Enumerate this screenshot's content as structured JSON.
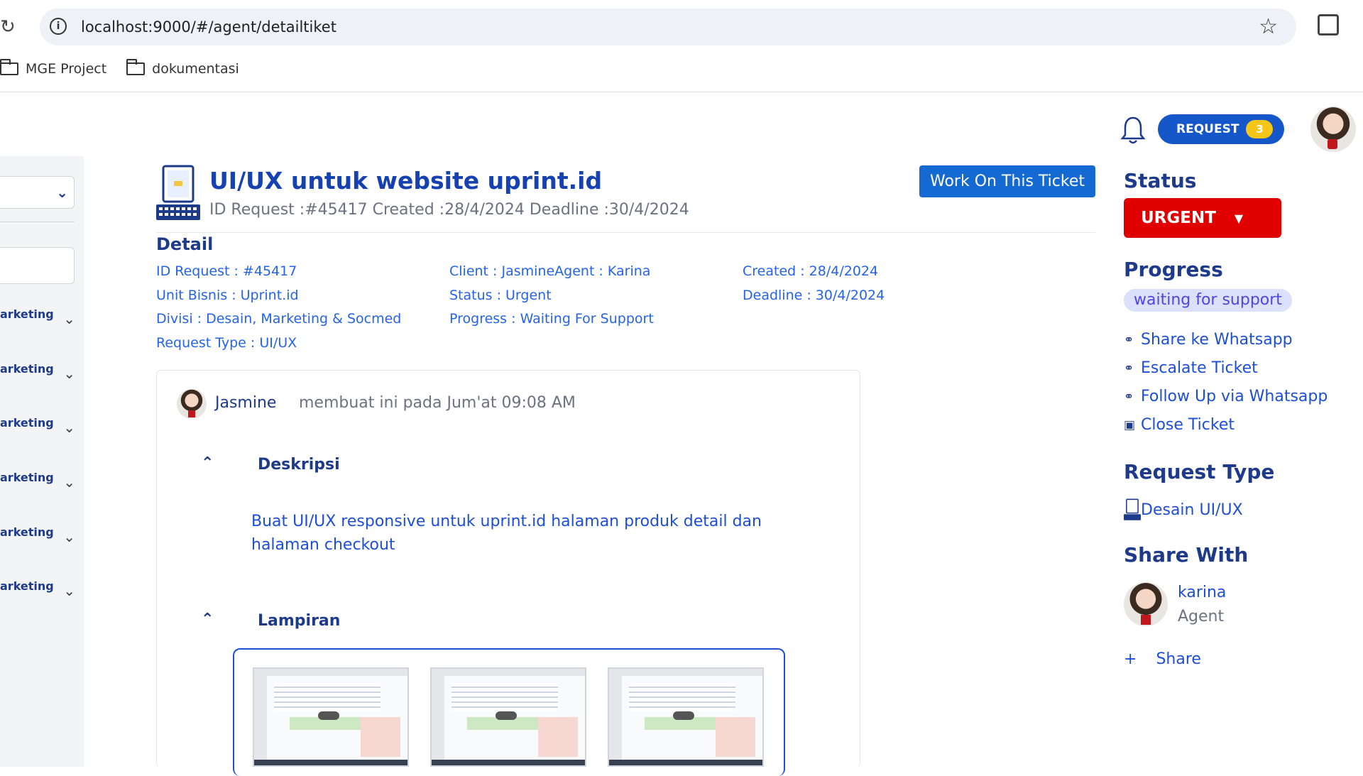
{
  "browser": {
    "url": "localhost:9000/#/agent/detailtiket",
    "bookmarks": [
      "MGE Project",
      "dokumentasi"
    ]
  },
  "topbar": {
    "request_label": "REQUEST",
    "request_count": "3"
  },
  "sidebar": {
    "items": [
      "arketing",
      "arketing",
      "arketing",
      "arketing",
      "arketing",
      "arketing"
    ]
  },
  "ticket": {
    "title": "UI/UX untuk website uprint.id",
    "subtitle": "ID Request :#45417  Created :28/4/2024  Deadline :30/4/2024",
    "work_button": "Work On This Ticket"
  },
  "detail": {
    "title": "Detail",
    "col1": [
      "ID Request  :  #45417",
      "Unit Bisnis  :  Uprint.id",
      "Divisi  :  Desain, Marketing & Socmed",
      "Request Type  :  UI/UX"
    ],
    "col2": [
      "Client  :  JasmineAgent  :  Karina",
      "Status  :  Urgent",
      "Progress  :  Waiting For Support"
    ],
    "col3": [
      "Created  :  28/4/2024",
      "Deadline  :  30/4/2024"
    ]
  },
  "card": {
    "author": "Jasmine",
    "created_note": "membuat ini pada Jum'at 09:08 AM",
    "description_title": "Deskripsi",
    "description": "Buat UI/UX responsive untuk uprint.id halaman produk detail dan halaman checkout",
    "attachments_title": "Lampiran",
    "attachment_count": 3
  },
  "right_panel": {
    "status_title": "Status",
    "status_value": "URGENT",
    "status_color": "#e00000",
    "progress_title": "Progress",
    "progress_value": "waiting for support",
    "actions": [
      {
        "label": "Share ke Whatsapp",
        "icon": "share-icon"
      },
      {
        "label": "Escalate Ticket",
        "icon": "share-icon"
      },
      {
        "label": "Follow Up via Whatsapp",
        "icon": "share-icon"
      },
      {
        "label": "Close Ticket",
        "icon": "close-ticket-icon"
      }
    ],
    "request_type_title": "Request Type",
    "request_type_value": "Desain UI/UX",
    "share_with_title": "Share With",
    "share_name": "karina",
    "share_role": "Agent",
    "share_button": "Share"
  }
}
